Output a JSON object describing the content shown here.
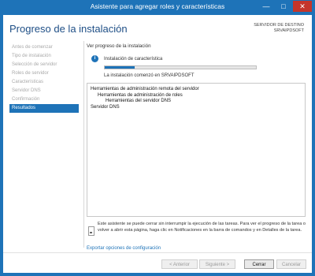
{
  "window": {
    "title": "Asistente para agregar roles y características",
    "minimize": "—",
    "maximize": "□",
    "close": "✕"
  },
  "header": {
    "page_title": "Progreso de la instalación",
    "destination_label": "SERVIDOR DE DESTINO",
    "destination_server": "SRVAIPDSOFT"
  },
  "nav": {
    "items": [
      {
        "label": "Antes de comenzar"
      },
      {
        "label": "Tipo de instalación"
      },
      {
        "label": "Selección de servidor"
      },
      {
        "label": "Roles de servidor"
      },
      {
        "label": "Características"
      },
      {
        "label": "Servidor DNS"
      },
      {
        "label": "Confirmación"
      },
      {
        "label": "Resultados"
      }
    ],
    "active_index": 7
  },
  "content": {
    "view_label": "Ver progreso de la instalación",
    "install_title": "Instalación de característica",
    "progress_fraction": 0.2,
    "install_status": "La instalación comenzó en SRVAIPDSOFT",
    "tree": [
      "Herramientas de administración remota del servidor",
      "Herramientas de administración de roles",
      "Herramientas del servidor DNS",
      "Servidor DNS"
    ],
    "notice": "Este asistente se puede cerrar sin interrumpir la ejecución de las tareas. Para ver el progreso de la tarea o volver a abrir esta página, haga clic en Notificaciones en la barra de comandos y en Detalles de la tarea.",
    "export_link": "Exportar opciones de configuración"
  },
  "footer": {
    "prev": "< Anterior",
    "next": "Siguiente >",
    "close": "Cerrar",
    "cancel": "Cancelar"
  },
  "colors": {
    "accent": "#1e73b8",
    "title_text": "#1f4f86"
  },
  "icons": {
    "info": "info-icon",
    "notice": "notice-icon"
  }
}
